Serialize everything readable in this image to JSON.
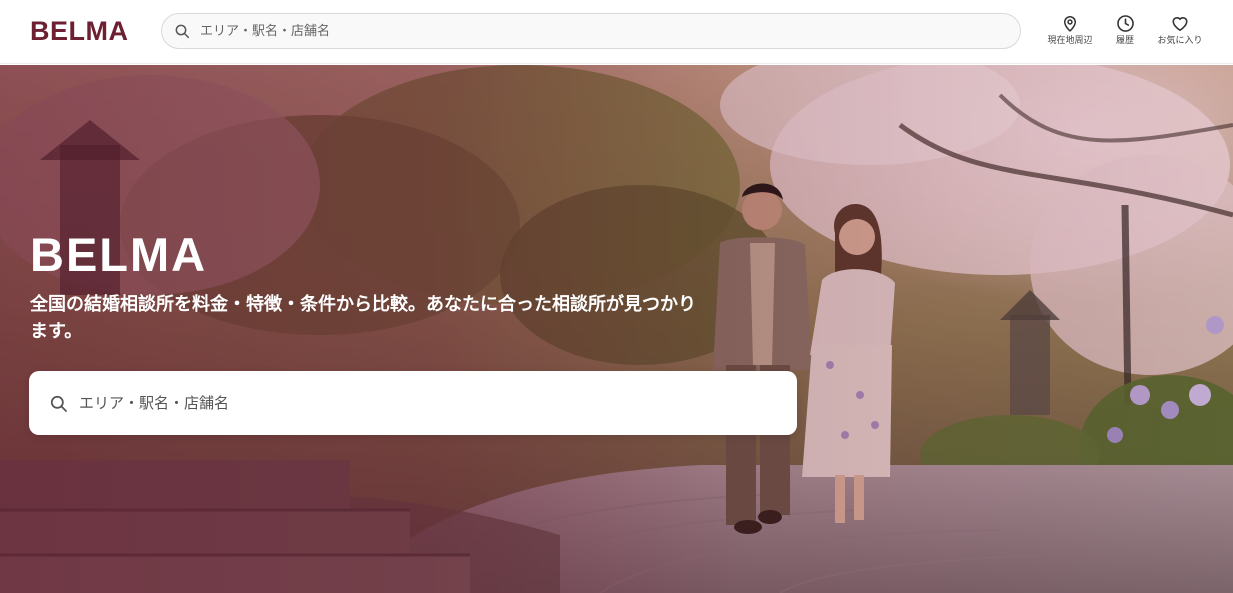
{
  "header": {
    "logo": "BELMA",
    "search": {
      "placeholder": "エリア・駅名・店舗名",
      "value": ""
    },
    "nav": [
      {
        "label": "現在地周辺",
        "icon": "map-pin-icon"
      },
      {
        "label": "履歴",
        "icon": "clock-icon"
      },
      {
        "label": "お気に入り",
        "icon": "heart-icon"
      }
    ]
  },
  "hero": {
    "title": "BELMA",
    "subtitle": "全国の結婚相談所を料金・特徴・条件から比較。あなたに合った相談所が見つかります。",
    "search": {
      "placeholder": "エリア・駅名・店舗名",
      "value": ""
    },
    "image_description_icon": "couple-walking-cherry-blossom-photo"
  },
  "colors": {
    "brand": "#6e1f31",
    "hero_overlay": "#691c34"
  }
}
